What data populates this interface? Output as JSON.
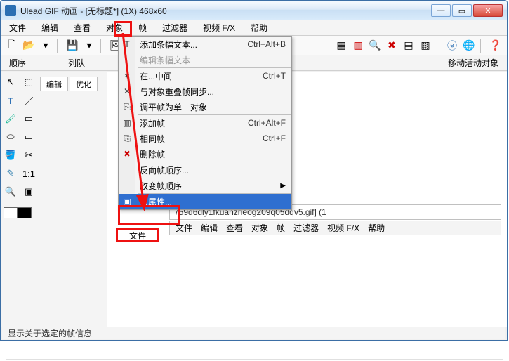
{
  "title": "Ulead GIF 动画 - [无标题*] (1X) 468x60",
  "menubar": [
    "文件",
    "编辑",
    "查看",
    "对象",
    "帧",
    "过滤器",
    "视频 F/X",
    "帮助"
  ],
  "row2": {
    "seq": "顺序",
    "queue": "列队",
    "move": "移动活动对象"
  },
  "panel_tabs": [
    "编辑",
    "优化"
  ],
  "dropdown": {
    "add_frame_text": "添加条幅文本...",
    "add_frame_text_sc": "Ctrl+Alt+B",
    "edit_frame_text": "编辑条幅文本",
    "between": "在...中间",
    "between_sc": "Ctrl+T",
    "sync_overlap": "与对象重叠帧同步...",
    "split_single": "调平帧为单一对象",
    "add_frame": "添加帧",
    "add_frame_sc": "Ctrl+Alt+F",
    "dup_frame": "相同帧",
    "dup_frame_sc": "Ctrl+F",
    "del_frame": "删除帧",
    "reverse_order": "反向帧顺序...",
    "change_order": "改变帧顺序",
    "frame_props": "帧属性..."
  },
  "file_line": "759d6dly1fkuahzrieog209q05dqv5.gif] (1",
  "inner_menubar": [
    "文件",
    "编辑",
    "查看",
    "对象",
    "帧",
    "过滤器",
    "视频 F/X",
    "帮助"
  ],
  "file_tab": "文件",
  "status": "显示关于选定的帧信息"
}
